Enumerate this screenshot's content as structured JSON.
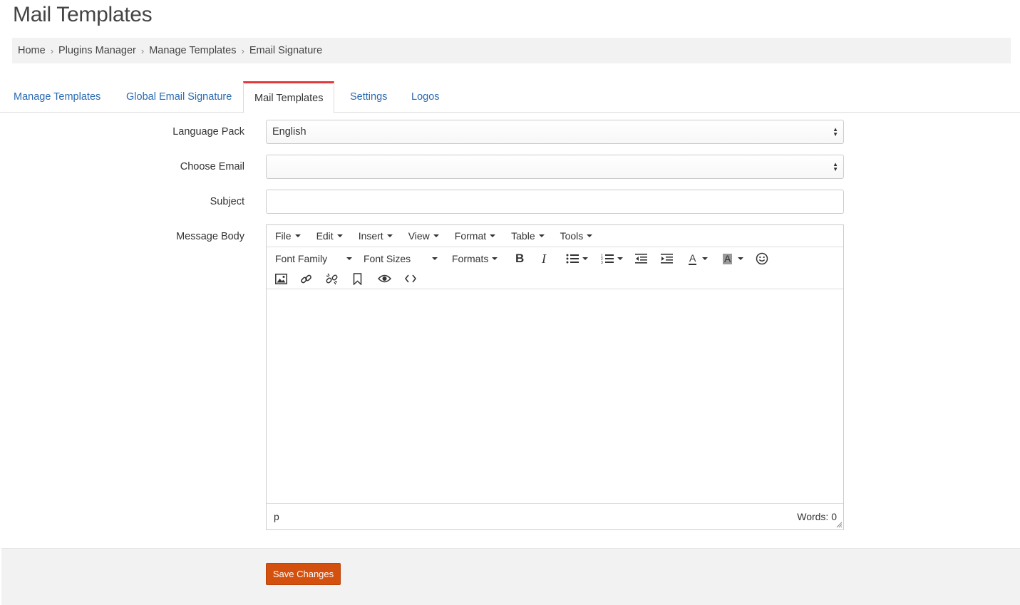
{
  "page": {
    "title": "Mail Templates"
  },
  "breadcrumb": [
    "Home",
    "Plugins Manager",
    "Manage Templates",
    "Email Signature"
  ],
  "tabs": [
    {
      "label": "Manage Templates",
      "active": false
    },
    {
      "label": "Global Email Signature",
      "active": false
    },
    {
      "label": "Mail Templates",
      "active": true
    },
    {
      "label": "Settings",
      "active": false
    },
    {
      "label": "Logos",
      "active": false
    }
  ],
  "form": {
    "language_pack": {
      "label": "Language Pack",
      "value": "English"
    },
    "choose_email": {
      "label": "Choose Email",
      "value": ""
    },
    "subject": {
      "label": "Subject",
      "value": ""
    },
    "message_body": {
      "label": "Message Body"
    }
  },
  "editor": {
    "menu": [
      "File",
      "Edit",
      "Insert",
      "View",
      "Format",
      "Table",
      "Tools"
    ],
    "toolbar": {
      "font_family": "Font Family",
      "font_sizes": "Font Sizes",
      "formats": "Formats",
      "bold": "B",
      "italic": "I",
      "text_color": "A",
      "bg_color": "A"
    },
    "status_path": "p",
    "word_count": "Words: 0"
  },
  "actions": {
    "save_label": "Save Changes"
  },
  "colors": {
    "accent": "#d4500e",
    "tab_active_border": "#e0383b",
    "link": "#2a6ab0"
  }
}
